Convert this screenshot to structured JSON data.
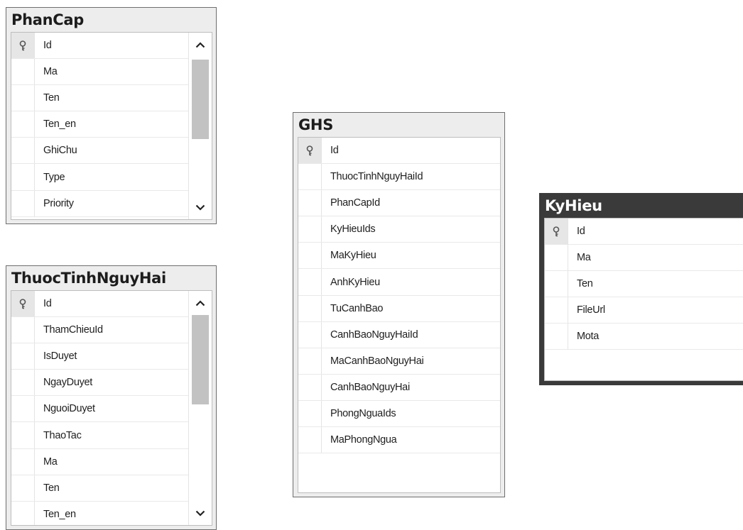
{
  "tables": {
    "phancap": {
      "name": "PhanCap",
      "columns": [
        "Id",
        "Ma",
        "Ten",
        "Ten_en",
        "GhiChu",
        "Type",
        "Priority"
      ],
      "primary_key": "Id",
      "has_scrollbar": true
    },
    "thuoctinh": {
      "name": "ThuocTinhNguyHai",
      "columns": [
        "Id",
        "ThamChieuId",
        "IsDuyet",
        "NgayDuyet",
        "NguoiDuyet",
        "ThaoTac",
        "Ma",
        "Ten",
        "Ten_en"
      ],
      "primary_key": "Id",
      "has_scrollbar": true
    },
    "ghs": {
      "name": "GHS",
      "columns": [
        "Id",
        "ThuocTinhNguyHaiId",
        "PhanCapId",
        "KyHieuIds",
        "MaKyHieu",
        "AnhKyHieu",
        "TuCanhBao",
        "CanhBaoNguyHaiId",
        "MaCanhBaoNguyHai",
        "CanhBaoNguyHai",
        "PhongNguaIds",
        "MaPhongNgua"
      ],
      "primary_key": "Id",
      "has_scrollbar": false
    },
    "kyhieu": {
      "name": "KyHieu",
      "columns": [
        "Id",
        "Ma",
        "Ten",
        "FileUrl",
        "Mota"
      ],
      "primary_key": "Id",
      "has_scrollbar": false,
      "selected": true
    }
  },
  "icons": {
    "primary_key": "key-icon",
    "scroll_up": "chevron-up-icon",
    "scroll_down": "chevron-down-icon"
  },
  "colors": {
    "selected_header": "#3a3a3a",
    "header": "#ededed",
    "scroll_thumb": "#c2c2c2"
  }
}
